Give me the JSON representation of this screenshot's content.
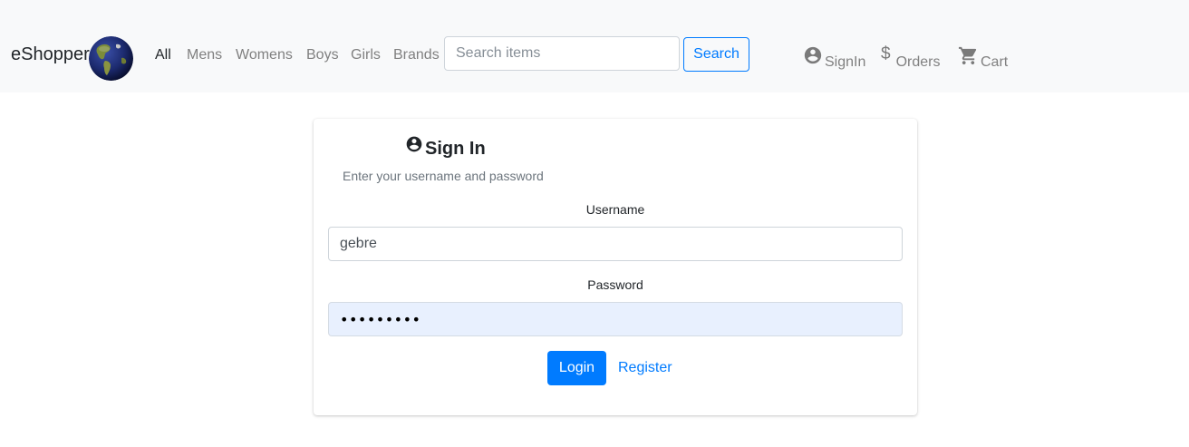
{
  "brand": {
    "name": "eShopper"
  },
  "nav": {
    "links": [
      "All",
      "Mens",
      "Womens",
      "Boys",
      "Girls",
      "Brands"
    ],
    "active": "All"
  },
  "search": {
    "placeholder": "Search items",
    "value": "",
    "button_label": "Search"
  },
  "user_links": {
    "signin": {
      "label": "SignIn",
      "icon": "user-circle-icon"
    },
    "orders": {
      "label": "Orders",
      "icon": "dollar-icon"
    },
    "cart": {
      "label": "Cart",
      "icon": "cart-icon"
    }
  },
  "login_card": {
    "title": "Sign In",
    "title_icon": "user-circle-icon",
    "subtitle": "Enter your username and password",
    "username_label": "Username",
    "username_value": "gebre",
    "password_label": "Password",
    "password_value": "•••••••••",
    "login_label": "Login",
    "register_label": "Register"
  },
  "colors": {
    "primary": "#007bff",
    "navbar_bg": "#f8f9fa",
    "muted_link": "#808080",
    "autofill_bg": "#e8f0fe"
  }
}
